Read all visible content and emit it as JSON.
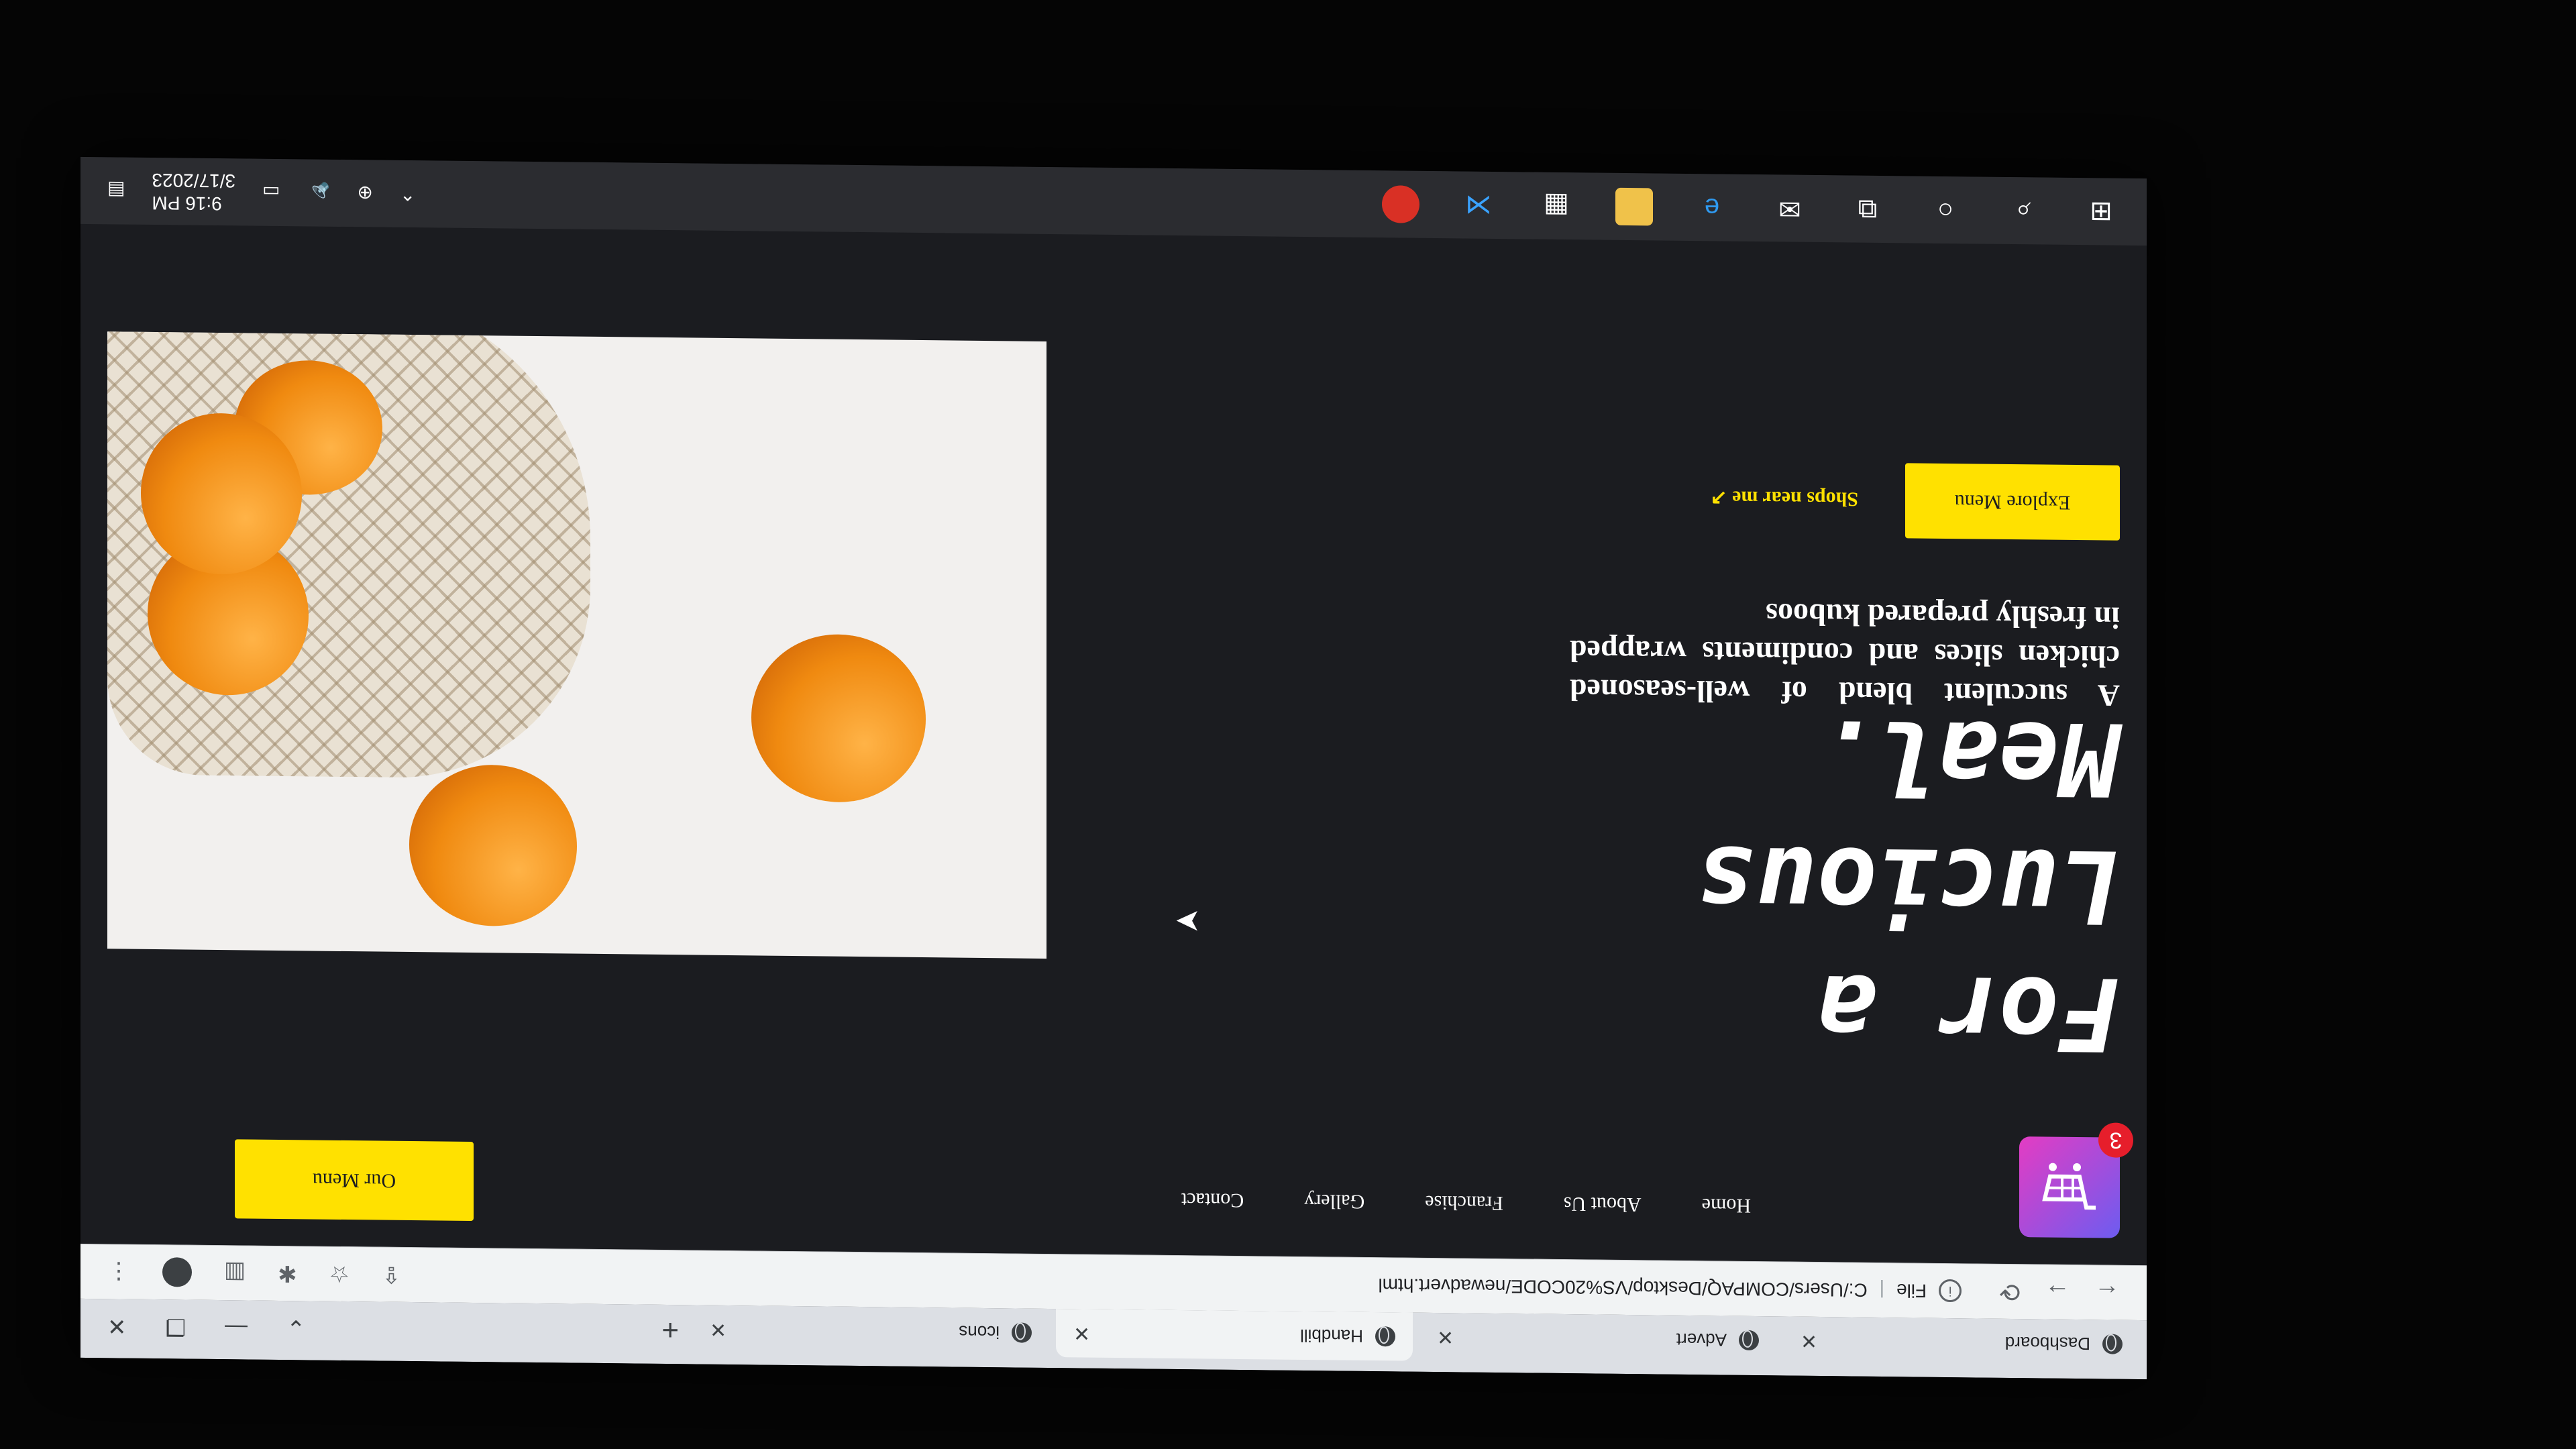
{
  "browser": {
    "tabs": [
      {
        "title": "Dashboard",
        "active": false
      },
      {
        "title": "Advert",
        "active": false
      },
      {
        "title": "Handbill",
        "active": true
      },
      {
        "title": "icons",
        "active": false
      }
    ],
    "new_tab": "+",
    "address": {
      "scheme": "File",
      "url": "C:/Users/COMPAQ/Desktop/VS%20CODE/newadvert.html"
    }
  },
  "site": {
    "logo_badge": "3",
    "nav": [
      "Home",
      "About Us",
      "Franchise",
      "Gallery",
      "Contact"
    ],
    "cta_top": "Our Menu",
    "hero_title": "For a Lucious Meal.",
    "hero_desc": "A succulent blend of well-seasoned chicken slices and condiments wrapped in freshly prepared kuboos",
    "explore_btn": "Explore Menu",
    "shops_link": "Shops near me ↗"
  },
  "taskbar": {
    "time": "9:16 PM",
    "date": "3/17/2023",
    "icons": [
      "windows-icon",
      "search-icon",
      "cortana-icon",
      "task-view-icon",
      "mail-icon",
      "edge-icon",
      "file-explorer-icon",
      "store-icon",
      "vscode-icon",
      "chrome-icon"
    ]
  },
  "colors": {
    "accent": "#ffe100",
    "page_bg": "#1b1c20",
    "logo_from": "#6d5cf0",
    "logo_to": "#e43cc3"
  }
}
